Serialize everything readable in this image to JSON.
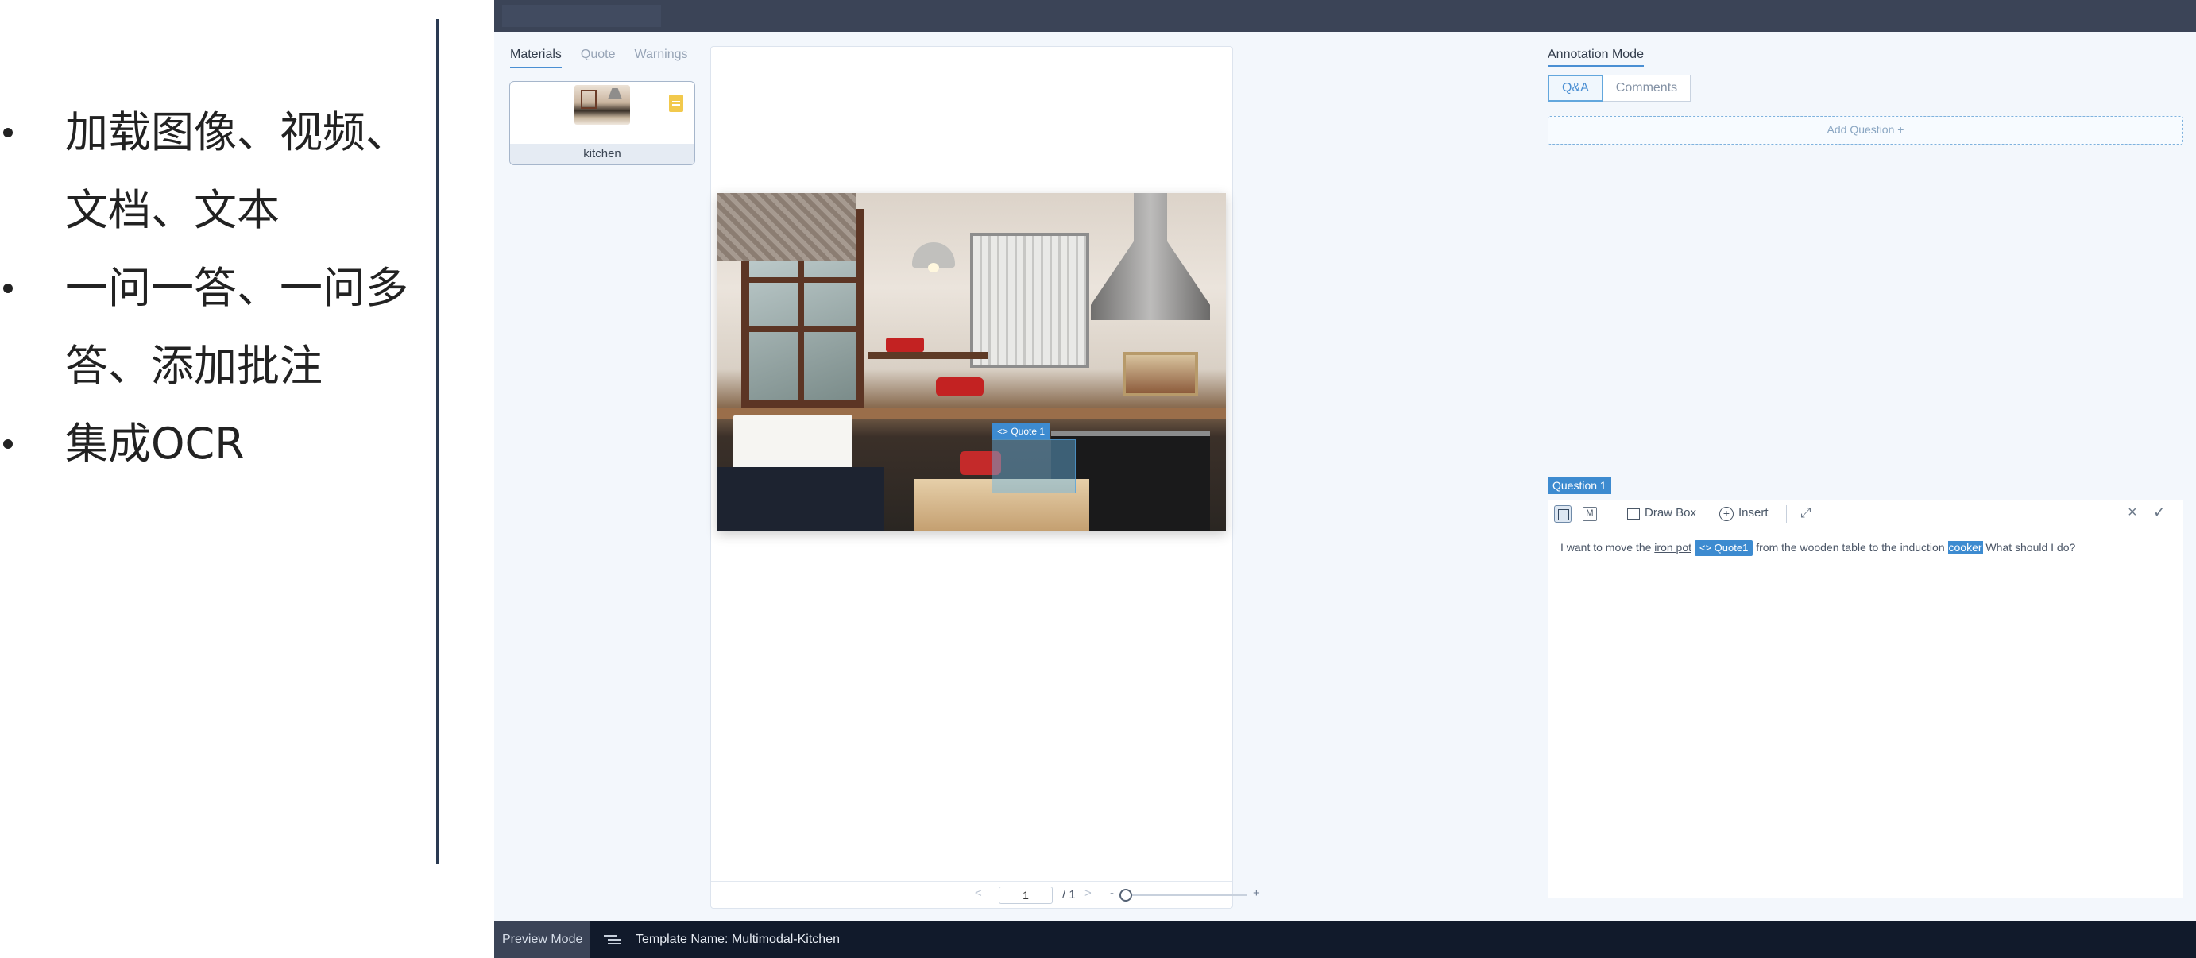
{
  "slide": {
    "bullets": [
      "加载图像、视频、",
      "文档、文本",
      "一问一答、一问多",
      "答、添加批注",
      "集成OCR"
    ]
  },
  "materials": {
    "tabs": [
      "Materials",
      "Quote",
      "Warnings"
    ],
    "active_tab": "Materials",
    "items": [
      {
        "label": "kitchen"
      }
    ]
  },
  "canvas": {
    "quote_tag": "<> Quote 1",
    "pager": {
      "prev": "<",
      "page": "1",
      "total": "/ 1",
      "next": ">",
      "zoom_minus": "-",
      "zoom_plus": "+"
    }
  },
  "annotation": {
    "title": "Annotation Mode",
    "modes": [
      "Q&A",
      "Comments"
    ],
    "active_mode": "Q&A",
    "add_question": "Add Question +",
    "question_label": "Question 1",
    "toolbar": {
      "t_icon": "text-mode-icon",
      "m_label": "M",
      "draw_box": "Draw Box",
      "insert": "Insert",
      "expand": "⤢",
      "close": "×",
      "confirm": "✓"
    },
    "question_text": {
      "part1": "I want to move the ",
      "link": "iron pot",
      "chip": "<> Quote1",
      "part2": " from the wooden table to the induction ",
      "selected": "cooker",
      "part3": " What should I do?"
    }
  },
  "status": {
    "mode": "Preview Mode",
    "template": "Template Name: Multimodal-Kitchen"
  },
  "colors": {
    "accent": "#3d8bd0",
    "topbar": "#3b4457",
    "statusbar": "#111a2b"
  }
}
